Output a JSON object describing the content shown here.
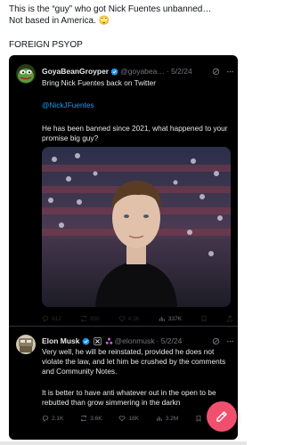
{
  "post": {
    "line1": "This is the “guy” who got Nick Fuentes unbanned…",
    "line2": "Not based in America. 🙄",
    "line3": "FOREIGN PSYOP"
  },
  "quoted": {
    "name": "GoyaBeanGroyper",
    "handle": "@goyabea…",
    "date": "· 5/2/24",
    "text1": "Bring Nick Fuentes back on Twitter",
    "mention": "@NickJFuentes",
    "text2": "He has been banned since 2021, what happened to your promise big guy?",
    "stats": {
      "replies": "912",
      "reposts": "350",
      "likes": "4.3K",
      "views": "337K"
    }
  },
  "reply": {
    "name": "Elon Musk",
    "handle": "@elonmusk",
    "date": "· 5/2/24",
    "text1": "Very well, he will be reinstated, provided he does not violate the law, and let him be crushed by the comments and Community Notes.",
    "text2": "It is better to have anti whatever out in the open to be rebutted than grow simmering in the darkn",
    "stats": {
      "replies": "2.1K",
      "reposts": "3.6K",
      "likes": "18K",
      "views": "3.2M"
    }
  },
  "colors": {
    "link": "#1d9bf0",
    "verified": "#1d9bf0",
    "gold": "#e2b719",
    "fab": "#f0506e",
    "muted": "#71767b"
  },
  "icons": [
    "pepe-avatar",
    "verified-badge",
    "grok-icon",
    "reply-icon",
    "repost-icon",
    "like-icon",
    "views-icon",
    "bookmark-icon",
    "share-icon",
    "x-affiliate-icon",
    "compose-icon"
  ]
}
